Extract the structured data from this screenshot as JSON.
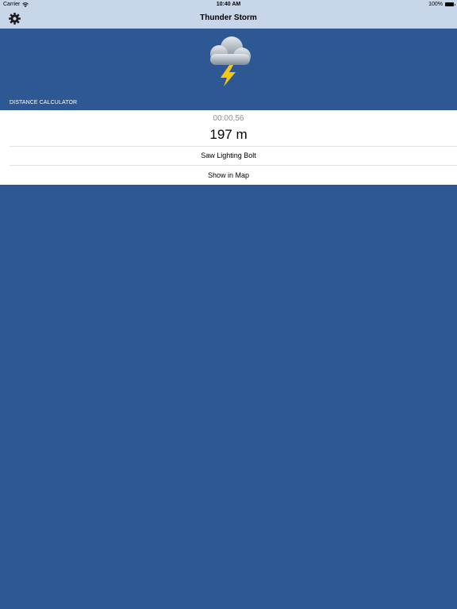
{
  "status_bar": {
    "carrier": "Carrier",
    "time": "10:40 AM",
    "battery": "100%"
  },
  "nav": {
    "title": "Thunder Storm",
    "left_icon": "gear-icon"
  },
  "header": {
    "icon": "thunderstorm-cloud-icon",
    "section_label": "DISTANCE CALCULATOR"
  },
  "calculator": {
    "timer": "00:00,56",
    "distance": "197 m",
    "actions": {
      "saw_bolt": "Saw Lighting Bolt",
      "show_map": "Show in Map"
    }
  },
  "colors": {
    "background": "#2e5894",
    "bar": "#c8d6ea",
    "card": "#ffffff",
    "timer_text": "#8e8e93",
    "bolt": "#f5c518"
  }
}
